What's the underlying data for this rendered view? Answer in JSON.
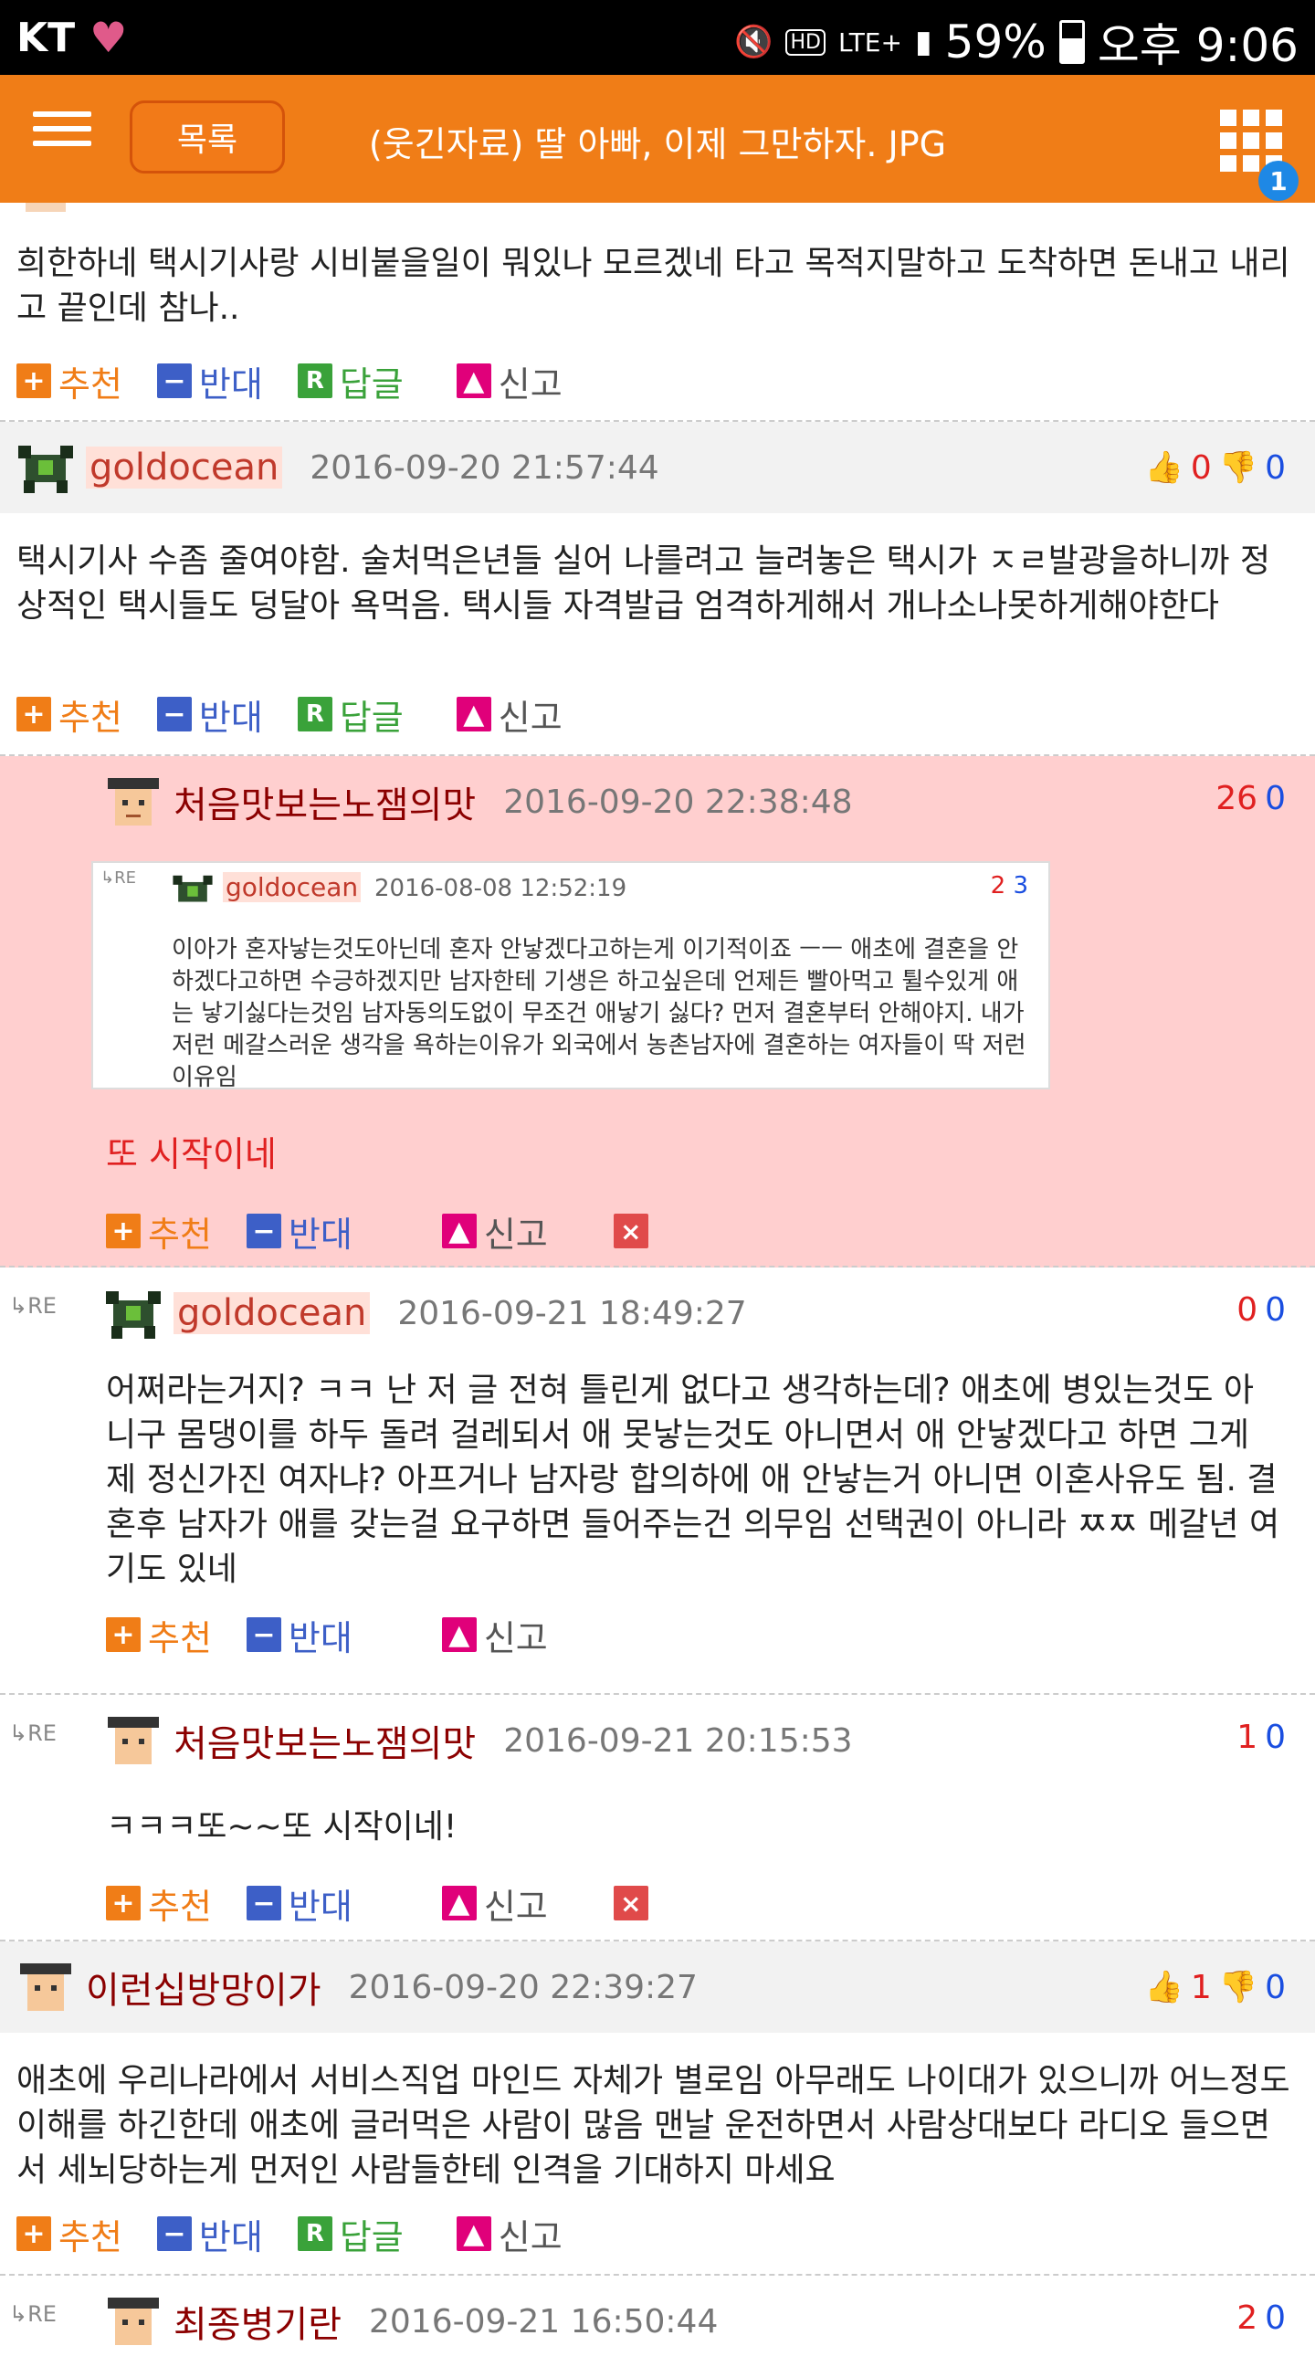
{
  "status": {
    "carrier": "KT",
    "network": "LTE+",
    "battery": "59%",
    "time": "오후 9:06"
  },
  "topbar": {
    "list_label": "목록",
    "title": "(웃긴자료) 딸 아빠, 이제 그만하자. JPG",
    "badge": "1"
  },
  "labels": {
    "recommend": "추천",
    "oppose": "반대",
    "reply": "답글",
    "report": "신고",
    "re": "RE"
  },
  "comments": [
    {
      "body": "희한하네 택시기사랑 시비붙을일이 뭐있나 모르겠네 타고 목적지말하고 도착하면 돈내고 내리고 끝인데 참나.."
    },
    {
      "user": "goldocean",
      "date": "2016-09-20 21:57:44",
      "up": "0",
      "down": "0",
      "body": "택시기사 수좀 줄여야함. 술처먹은년들 실어 나를려고 늘려놓은 택시가 ㅈㄹ발광을하니까 정상적인 택시들도 덩달아 욕먹음. 택시들 자격발급 엄격하게해서 개나소나못하게해야한다"
    },
    {
      "user": "처음맛보는노잼의맛",
      "date": "2016-09-20 22:38:48",
      "up": "26",
      "down": "0",
      "quote": {
        "user": "goldocean",
        "date": "2016-08-08 12:52:19",
        "up": "2",
        "down": "3",
        "body": "이아가 혼자낳는것도아닌데 혼자 안낳겠다고하는게 이기적이죠 ㅡㅡ 애초에 결혼을 안하겠다고하면 수긍하겠지만 남자한테 기생은 하고싶은데 언제든 빨아먹고 튈수있게 애는 낳기싫다는것임 남자동의도없이 무조건 애낳기 싫다? 먼저 결혼부터 안해야지. 내가 저런 메갈스러운 생각을 욕하는이유가 외국에서 농촌남자에 결혼하는 여자들이 딱 저런 이유임"
      },
      "body": "또 시작이네"
    },
    {
      "user": "goldocean",
      "date": "2016-09-21 18:49:27",
      "up": "0",
      "down": "0",
      "body": "어쩌라는거지? ㅋㅋ 난 저 글 전혀 틀린게 없다고 생각하는데? 애초에 병있는것도 아니구 몸댕이를 하두 돌려 걸레되서 애 못낳는것도 아니면서 애 안낳겠다고 하면 그게 제 정신가진 여자냐? 아프거나 남자랑 합의하에 애 안낳는거 아니면 이혼사유도 됨. 결혼후 남자가 애를 갖는걸 요구하면 들어주는건 의무임 선택권이 아니라 ㅉㅉ 메갈년 여기도 있네"
    },
    {
      "user": "처음맛보는노잼의맛",
      "date": "2016-09-21 20:15:53",
      "up": "1",
      "down": "0",
      "body": "ㅋㅋㅋ또~~또 시작이네!"
    },
    {
      "user": "이런십방망이가",
      "date": "2016-09-20 22:39:27",
      "up": "1",
      "down": "0",
      "body": "애초에 우리나라에서 서비스직업 마인드 자체가 별로임 아무래도 나이대가 있으니까 어느정도 이해를 하긴한데 애초에 글러먹은 사람이 많음 맨날 운전하면서 사람상대보다 라디오 들으면서 세뇌당하는게 먼저인 사람들한테 인격을 기대하지 마세요"
    },
    {
      "user": "최종병기란",
      "date": "2016-09-21 16:50:44",
      "up": "2",
      "down": "0"
    }
  ]
}
